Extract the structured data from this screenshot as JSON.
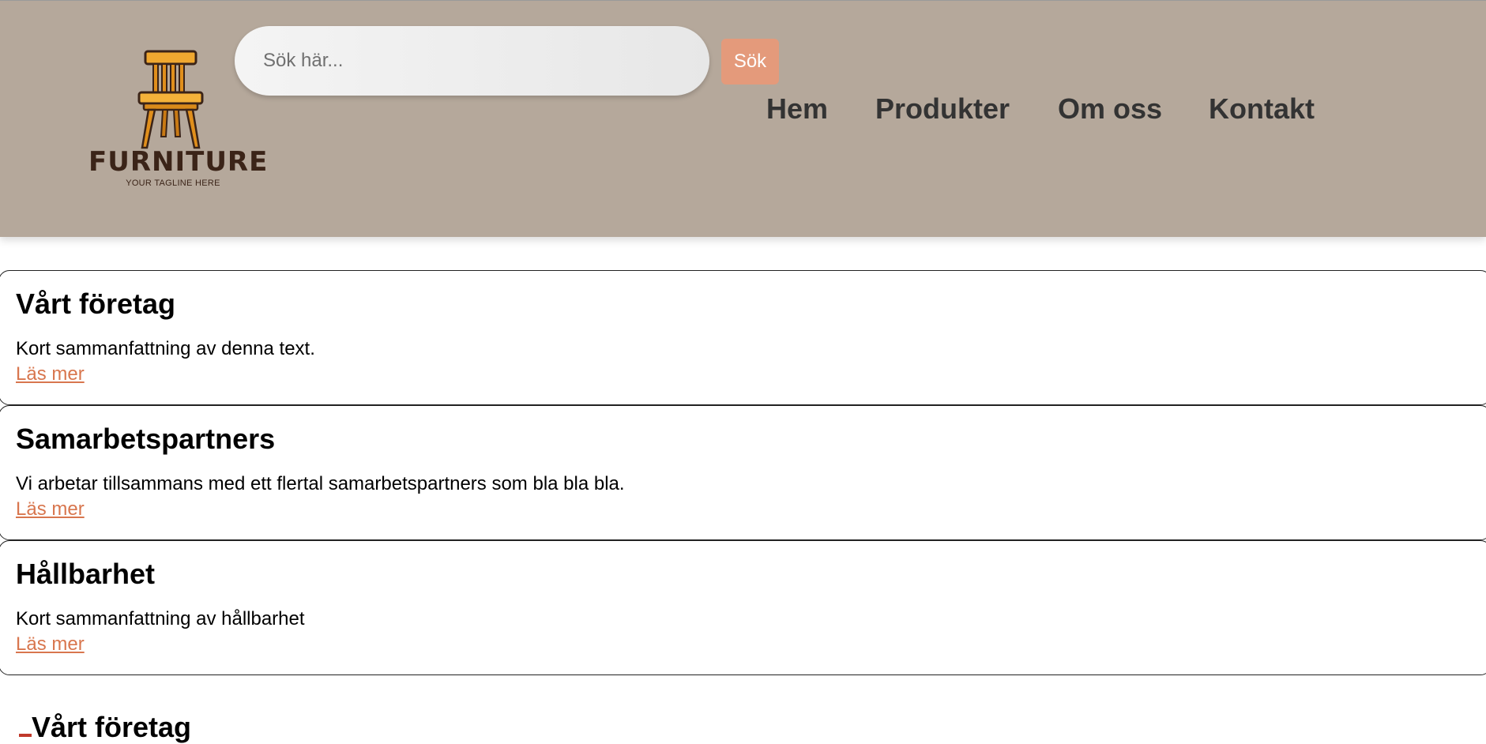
{
  "header": {
    "logo": {
      "wordmark": "FURNITURE",
      "tagline": "YOUR TAGLINE HERE",
      "icon": "chair-icon"
    },
    "search": {
      "placeholder": "Sök här...",
      "value": "",
      "button_label": "Sök"
    },
    "nav": [
      {
        "label": "Hem"
      },
      {
        "label": "Produkter"
      },
      {
        "label": "Om oss"
      },
      {
        "label": "Kontakt"
      }
    ]
  },
  "cards": [
    {
      "title": "Vårt företag",
      "text": "Kort sammanfattning av denna text.",
      "link": "Läs mer"
    },
    {
      "title": "Samarbetspartners",
      "text": "Vi arbetar tillsammans med ett flertal samarbetspartners som bla bla bla.",
      "link": "Läs mer"
    },
    {
      "title": "Hållbarhet",
      "text": "Kort sammanfattning av hållbarhet",
      "link": "Läs mer"
    }
  ],
  "section": {
    "heading": "Vårt företag"
  },
  "colors": {
    "header_bg": "#b5a89b",
    "accent": "#e49a7b",
    "link": "#d8764e",
    "nav_text": "#333333"
  }
}
